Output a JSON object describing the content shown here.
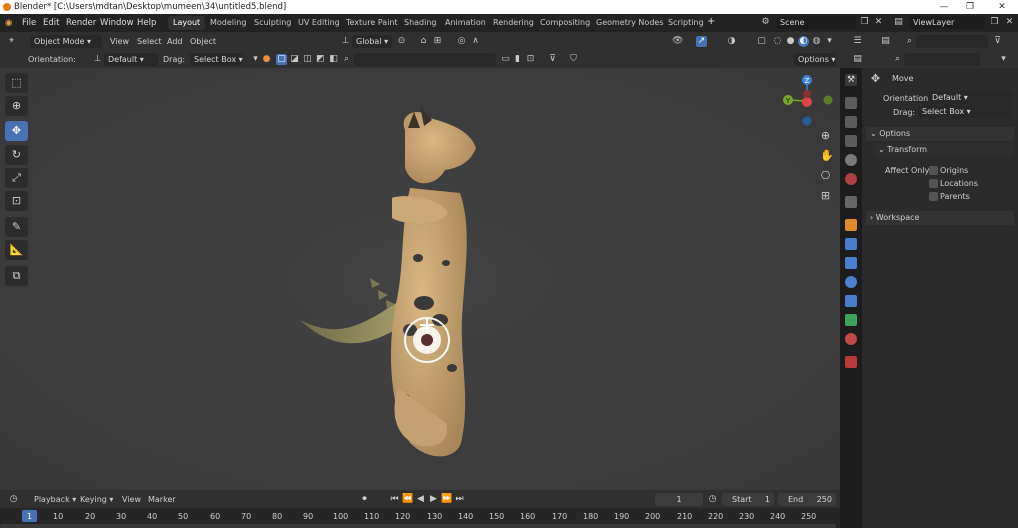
{
  "window": {
    "title": "Blender* [C:\\Users\\mdtan\\Desktop\\mumeen\\34\\untitled5.blend]",
    "minimize": "—",
    "maximize": "❐",
    "close": "✕"
  },
  "menu": [
    "File",
    "Edit",
    "Render",
    "Window",
    "Help"
  ],
  "workspaces": [
    "Layout",
    "Modeling",
    "Sculpting",
    "UV Editing",
    "Texture Paint",
    "Shading",
    "Animation",
    "Rendering",
    "Compositing",
    "Geometry Nodes",
    "Scripting"
  ],
  "add_workspace": "+",
  "scene": "Scene",
  "view_layer": "ViewLayer",
  "viewport_header": {
    "mode": "Object Mode",
    "menus": [
      "View",
      "Select",
      "Add",
      "Object"
    ],
    "transform_orientation": "Global"
  },
  "tool_settings": {
    "orientation_label": "Orientation:",
    "orientation_value": "Default",
    "drag_label": "Drag:",
    "drag_value": "Select Box",
    "options": "Options"
  },
  "gizmo": {
    "z": "Z",
    "y": "Y"
  },
  "right_panel": {
    "tool_name": "Move",
    "orientation_label": "Orientation",
    "orientation_value": "Default",
    "drag_label": "Drag:",
    "drag_value": "Select Box",
    "options_section": "Options",
    "transform_section": "Transform",
    "affect_only": "Affect Only",
    "checkboxes": [
      "Origins",
      "Locations",
      "Parents"
    ],
    "workspace_section": "Workspace"
  },
  "timeline": {
    "menus": [
      "Playback",
      "Keying",
      "View",
      "Marker"
    ],
    "current_frame": "1",
    "start_label": "Start",
    "start": "1",
    "end_label": "End",
    "end": "250"
  },
  "ruler": [
    "1",
    "10",
    "20",
    "30",
    "40",
    "50",
    "60",
    "70",
    "80",
    "90",
    "100",
    "110",
    "120",
    "130",
    "140",
    "150",
    "160",
    "170",
    "180",
    "190",
    "200",
    "210",
    "220",
    "230",
    "240",
    "250"
  ],
  "colors": {
    "active_blue": "#4772b3",
    "gizmo_x": "#e04545",
    "gizmo_y": "#7ba62c",
    "gizmo_z": "#3e82e0",
    "frame_marker": "#4772b3"
  }
}
